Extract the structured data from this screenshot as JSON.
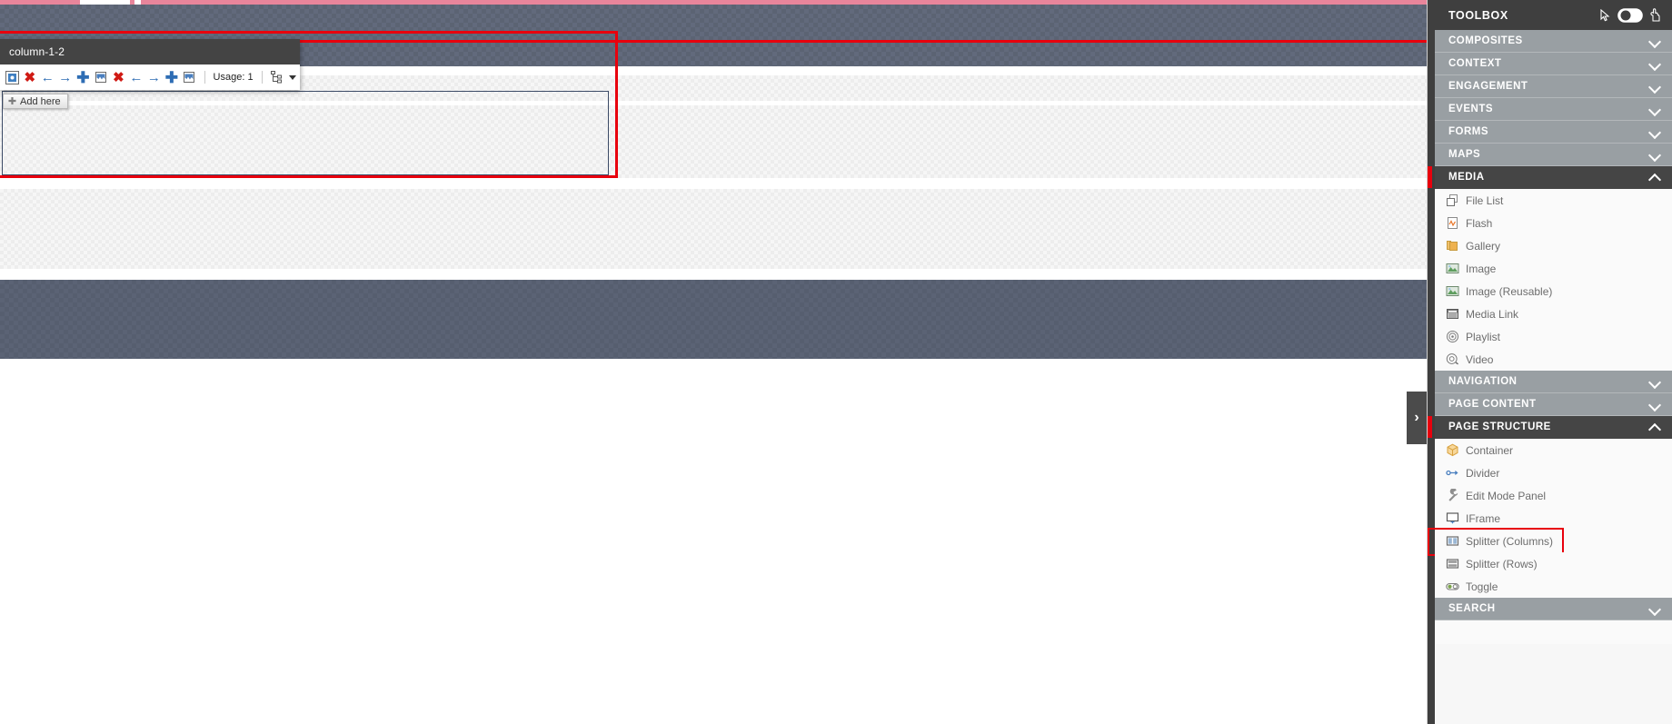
{
  "canvas": {
    "selected_component": {
      "title": "column-1-2",
      "usage_label": "Usage: 1",
      "toolbar_buttons": [
        {
          "name": "properties-icon",
          "glyph": "settings"
        },
        {
          "name": "delete-icon",
          "glyph": "x"
        },
        {
          "name": "move-left-icon",
          "glyph": "arrow-left"
        },
        {
          "name": "move-right-icon",
          "glyph": "arrow-right"
        },
        {
          "name": "add-icon",
          "glyph": "plus"
        },
        {
          "name": "paste-icon",
          "glyph": "bucket"
        },
        {
          "name": "delete-parent-icon",
          "glyph": "x"
        },
        {
          "name": "move-parent-left-icon",
          "glyph": "arrow-left"
        },
        {
          "name": "move-parent-right-icon",
          "glyph": "arrow-right"
        },
        {
          "name": "add-parent-icon",
          "glyph": "plus"
        },
        {
          "name": "paste-parent-icon",
          "glyph": "bucket"
        }
      ],
      "hierarchy_icon": "tree-icon",
      "dropdown_caret": "chevron-down-icon"
    },
    "add_here_label": "Add here",
    "collapse_handle": "›"
  },
  "toolbox": {
    "title": "TOOLBOX",
    "header_icons": [
      "cursor-icon",
      "toggle-switch-icon",
      "hand-icon"
    ],
    "accent_color": "#e8000d",
    "groups": [
      {
        "label": "COMPOSITES",
        "open": false,
        "items": []
      },
      {
        "label": "CONTEXT",
        "open": false,
        "items": []
      },
      {
        "label": "ENGAGEMENT",
        "open": false,
        "items": []
      },
      {
        "label": "EVENTS",
        "open": false,
        "items": []
      },
      {
        "label": "FORMS",
        "open": false,
        "items": []
      },
      {
        "label": "MAPS",
        "open": false,
        "items": []
      },
      {
        "label": "MEDIA",
        "open": true,
        "items": [
          {
            "label": "File List",
            "icon": "file-list-icon",
            "highlighted": false
          },
          {
            "label": "Flash",
            "icon": "flash-icon",
            "highlighted": false
          },
          {
            "label": "Gallery",
            "icon": "gallery-icon",
            "highlighted": false
          },
          {
            "label": "Image",
            "icon": "image-icon",
            "highlighted": false
          },
          {
            "label": "Image (Reusable)",
            "icon": "image-icon",
            "highlighted": false
          },
          {
            "label": "Media Link",
            "icon": "media-link-icon",
            "highlighted": false
          },
          {
            "label": "Playlist",
            "icon": "playlist-icon",
            "highlighted": false
          },
          {
            "label": "Video",
            "icon": "video-icon",
            "highlighted": false
          }
        ]
      },
      {
        "label": "NAVIGATION",
        "open": false,
        "items": []
      },
      {
        "label": "PAGE CONTENT",
        "open": false,
        "items": []
      },
      {
        "label": "PAGE STRUCTURE",
        "open": true,
        "items": [
          {
            "label": "Container",
            "icon": "container-icon",
            "highlighted": false
          },
          {
            "label": "Divider",
            "icon": "divider-icon",
            "highlighted": false
          },
          {
            "label": "Edit Mode Panel",
            "icon": "wrench-icon",
            "highlighted": false
          },
          {
            "label": "IFrame",
            "icon": "iframe-icon",
            "highlighted": false
          },
          {
            "label": "Splitter (Columns)",
            "icon": "splitter-columns-icon",
            "highlighted": true
          },
          {
            "label": "Splitter (Rows)",
            "icon": "splitter-rows-icon",
            "highlighted": false
          },
          {
            "label": "Toggle",
            "icon": "toggle-icon",
            "highlighted": false
          }
        ]
      },
      {
        "label": "SEARCH",
        "open": false,
        "items": []
      }
    ]
  }
}
